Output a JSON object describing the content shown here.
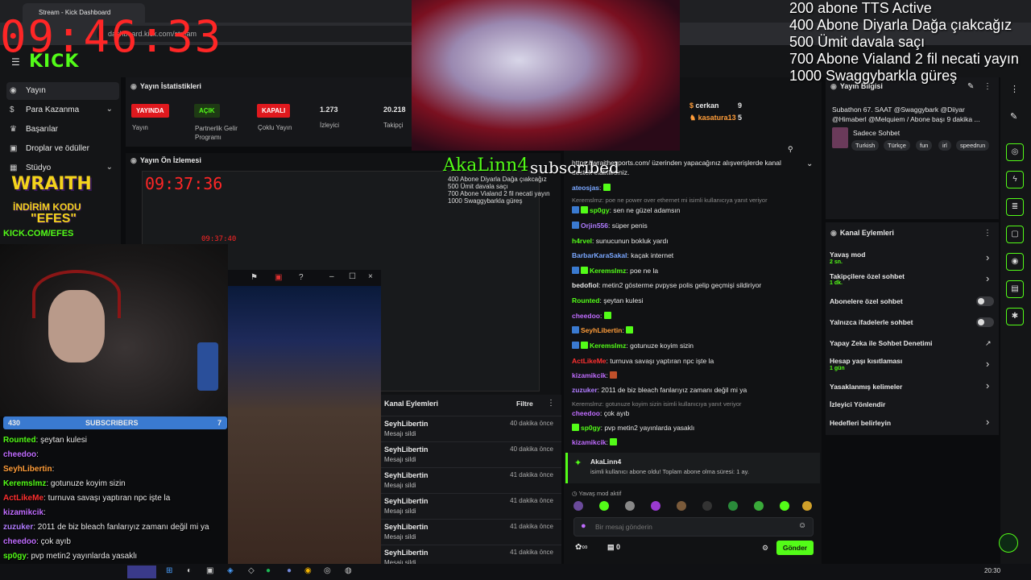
{
  "browser": {
    "tab_title": "Stream - Kick Dashboard",
    "url": "dashboard.kick.com/stream"
  },
  "header": {
    "logo": "KICK"
  },
  "sidebar": {
    "items": [
      {
        "label": "Yayın",
        "icon": "stream-icon"
      },
      {
        "label": "Para Kazanma",
        "icon": "money-icon"
      },
      {
        "label": "Başarılar",
        "icon": "trophy-icon"
      },
      {
        "label": "Droplar ve ödüller",
        "icon": "gift-icon"
      },
      {
        "label": "Stüdyo",
        "icon": "studio-icon"
      }
    ]
  },
  "stats": {
    "title": "Yayın İstatistikleri",
    "items": [
      {
        "badge": "YAYINDA",
        "label": "Yayın"
      },
      {
        "badge": "AÇIK",
        "label": "Partnerlik Gelir Programı"
      },
      {
        "badge": "KAPALI",
        "label": "Çoklu Yayın"
      },
      {
        "value": "1.273",
        "label": "İzleyici"
      },
      {
        "value": "20.218",
        "label": "Takipçi"
      }
    ]
  },
  "preview": {
    "title": "Yayın Ön İzlemesi"
  },
  "events": {
    "title": "Kanal Eylemleri",
    "filter": "Filtre",
    "rows": [
      {
        "name": "SeyhLibertin",
        "sub": "Mesajı sildi",
        "time": "40 dakika önce"
      },
      {
        "name": "SeyhLibertin",
        "sub": "Mesajı sildi",
        "time": "40 dakika önce"
      },
      {
        "name": "SeyhLibertin",
        "sub": "Mesajı sildi",
        "time": "41 dakika önce"
      },
      {
        "name": "SeyhLibertin",
        "sub": "Mesajı sildi",
        "time": "41 dakika önce"
      },
      {
        "name": "SeyhLibertin",
        "sub": "Mesajı sildi",
        "time": "41 dakika önce"
      },
      {
        "name": "SeyhLibertin",
        "sub": "Mesajı sildi",
        "time": "41 dakika önce"
      }
    ]
  },
  "leaderboard": [
    {
      "name": "cerkan",
      "value": "9"
    },
    {
      "name": "kasatura13",
      "value": "5"
    }
  ],
  "chat": {
    "pinned": "https://wraithesports.com/ üzerinden yapacağınız alışverişlerde kanal destek olabilirsiniz.",
    "messages": [
      {
        "user": "ateosjas",
        "text": "",
        "color": "#7aa7ff"
      },
      {
        "user": "",
        "text": "Keremslmz: poe ne power over ethernet mi isimli kullanıcıya yanıt veriyor",
        "color": "#888888"
      },
      {
        "user": "sp0gy",
        "text": "sen ne güzel adamsın",
        "color": "#53fc18"
      },
      {
        "user": "Orjin556",
        "text": "süper penis",
        "color": "#b07cff"
      },
      {
        "user": "h4rvel",
        "text": "sunucunun bokluk yardı",
        "color": "#53fc18"
      },
      {
        "user": "BarbarKaraSakal",
        "text": "kaçak internet",
        "color": "#7aa7ff"
      },
      {
        "user": "Keremslmz",
        "text": "poe ne la",
        "color": "#53fc18"
      },
      {
        "user": "bedofiol",
        "text": "metin2 gösterme pvpyse polis gelip geçmişi sildiriyor",
        "color": "#e6e6e6"
      },
      {
        "user": "Rounted",
        "text": "şeytan kulesi",
        "color": "#53fc18"
      },
      {
        "user": "cheedoo",
        "text": "",
        "color": "#c06cff"
      },
      {
        "user": "SeyhLibertin",
        "text": "",
        "color": "#ff9d3a"
      },
      {
        "user": "Keremslmz",
        "text": "gotunuze koyim sizin",
        "color": "#53fc18"
      },
      {
        "user": "ActLikeMe",
        "text": "turnuva savaşı yaptıran npc işte la",
        "color": "#ff3030"
      },
      {
        "user": "kizamikcik",
        "text": "",
        "color": "#c06cff"
      },
      {
        "user": "zuzuker",
        "text": "2011 de biz bleach fanlarıyız zamanı değil mi ya",
        "color": "#b07cff"
      },
      {
        "user": "",
        "text": "Keremslmz: gotunuze koyim sizin isimli kullanıcıya yanıt veriyor",
        "color": "#888888"
      },
      {
        "user": "cheedoo",
        "text": "çok ayıb",
        "color": "#c06cff"
      },
      {
        "user": "sp0gy",
        "text": "pvp metin2 yayınlarda yasaklı",
        "color": "#53fc18"
      },
      {
        "user": "kizamikcik",
        "text": "",
        "color": "#c06cff"
      }
    ],
    "sub_event": {
      "user": "AkaLinn4",
      "text": "isimli kullanıcı abone oldu! Toplam abone olma süresi: 1 ay."
    },
    "slow_mode": "Yavaş mod aktif",
    "input_placeholder": "Bir mesaj gönderin",
    "send_label": "Gönder",
    "points": "0"
  },
  "info": {
    "title": "Yayın Bilgisi",
    "stream_title": "Subathon 67. SAAT @Swaggybark @Diiyar @Himaberl @Melquiem / Abone başı 9 dakika ...",
    "category": "Sadece Sohbet",
    "tags": [
      "Turkish",
      "Türkçe",
      "fun",
      "irl",
      "speedrun"
    ]
  },
  "actions": {
    "title": "Kanal Eylemleri",
    "items": [
      {
        "label": "Yavaş mod",
        "sub": "2 sn.",
        "control": "chevron"
      },
      {
        "label": "Takipçilere özel sohbet",
        "sub": "1 dk.",
        "control": "chevron"
      },
      {
        "label": "Abonelere özel sohbet",
        "sub": "",
        "control": "toggle"
      },
      {
        "label": "Yalnızca ifadelerle sohbet",
        "sub": "",
        "control": "toggle"
      },
      {
        "label": "Yapay Zeka ile Sohbet Denetimi",
        "sub": "",
        "control": "external"
      },
      {
        "label": "Hesap yaşı kısıtlaması",
        "sub": "1 gün",
        "control": "chevron"
      },
      {
        "label": "Yasaklanmış kelimeler",
        "sub": "",
        "control": "chevron"
      },
      {
        "label": "İzleyici Yönlendir",
        "sub": "",
        "control": "none"
      },
      {
        "label": "Hedefleri belirleyin",
        "sub": "",
        "control": "chevron"
      }
    ]
  },
  "overlay": {
    "clock": "09:46:33",
    "goals": [
      "200 abone TTS Active",
      "400 Abone Diyarla Dağa çıakcağız",
      "500 Ümit davala saçı",
      "700 Abone Vialand 2 fil necati yayın",
      "1000 Swaggybarkla güreş"
    ],
    "sponsor_name": "WRAITH",
    "sponsor_line1": "İNDİRİM KODU",
    "sponsor_line2": "\"EFES\"",
    "sponsor_url": "KICK.COM/EFES",
    "sub_alert_name": "AkaLinn4",
    "sub_alert_text": "subscribed",
    "mini_clock": "09:37:36",
    "mini_clock2": "09:37:40",
    "subbar_left": "430",
    "subbar_label": "SUBSCRIBERS",
    "subbar_right": "7",
    "chat": [
      {
        "user": "Rounted",
        "text": ": şeytan kulesi",
        "color": "#53fc18"
      },
      {
        "user": "cheedoo",
        "text": ":",
        "color": "#c06cff"
      },
      {
        "user": "SeyhLibertin",
        "text": ":",
        "color": "#ff9d3a"
      },
      {
        "user": "Keremslmz",
        "text": ": gotunuze koyim sizin",
        "color": "#53fc18"
      },
      {
        "user": "ActLikeMe",
        "text": ": turnuva savaşı yaptıran npc işte la",
        "color": "#ff3030"
      },
      {
        "user": "kizamikcik",
        "text": ":",
        "color": "#c06cff"
      },
      {
        "user": "zuzuker",
        "text": ": 2011 de biz bleach fanlarıyız zamanı değil mi ya",
        "color": "#b07cff"
      },
      {
        "user": "cheedoo",
        "text": ": çok ayıb",
        "color": "#c06cff"
      },
      {
        "user": "sp0gy",
        "text": ": pvp metin2 yayınlarda yasaklı",
        "color": "#53fc18"
      }
    ]
  },
  "taskbar": {
    "time": "20:30"
  },
  "colors": {
    "accent": "#53fc18",
    "live": "#e0191e",
    "clock": "#ff2626"
  }
}
